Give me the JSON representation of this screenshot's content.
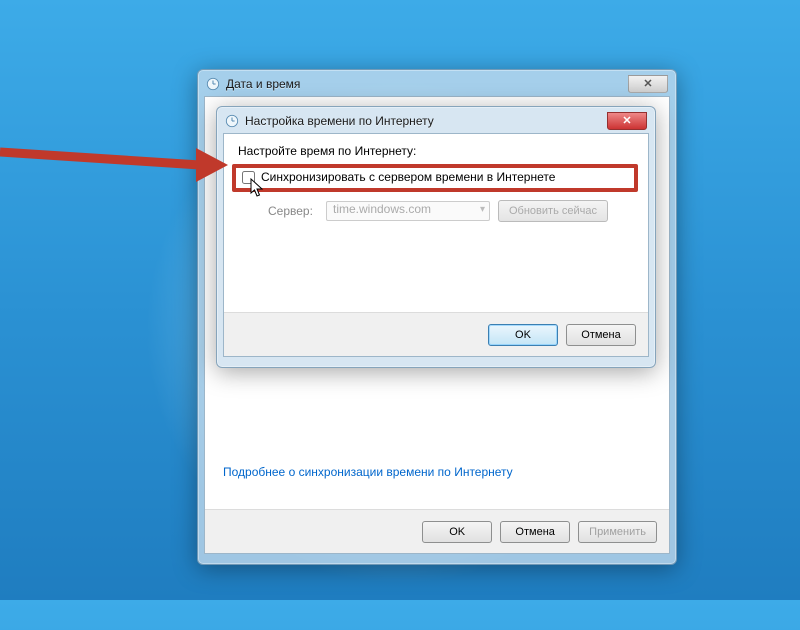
{
  "parent": {
    "title": "Дата и время",
    "link": "Подробнее о синхронизации времени по Интернету",
    "buttons": {
      "ok": "OK",
      "cancel": "Отмена",
      "apply": "Применить"
    }
  },
  "dialog": {
    "title": "Настройка времени по Интернету",
    "instruction": "Настройте время по Интернету:",
    "checkbox_label": "Синхронизировать с сервером времени в Интернете",
    "server_label": "Сервер:",
    "server_value": "time.windows.com",
    "update_now": "Обновить сейчас",
    "buttons": {
      "ok": "OK",
      "cancel": "Отмена"
    }
  }
}
